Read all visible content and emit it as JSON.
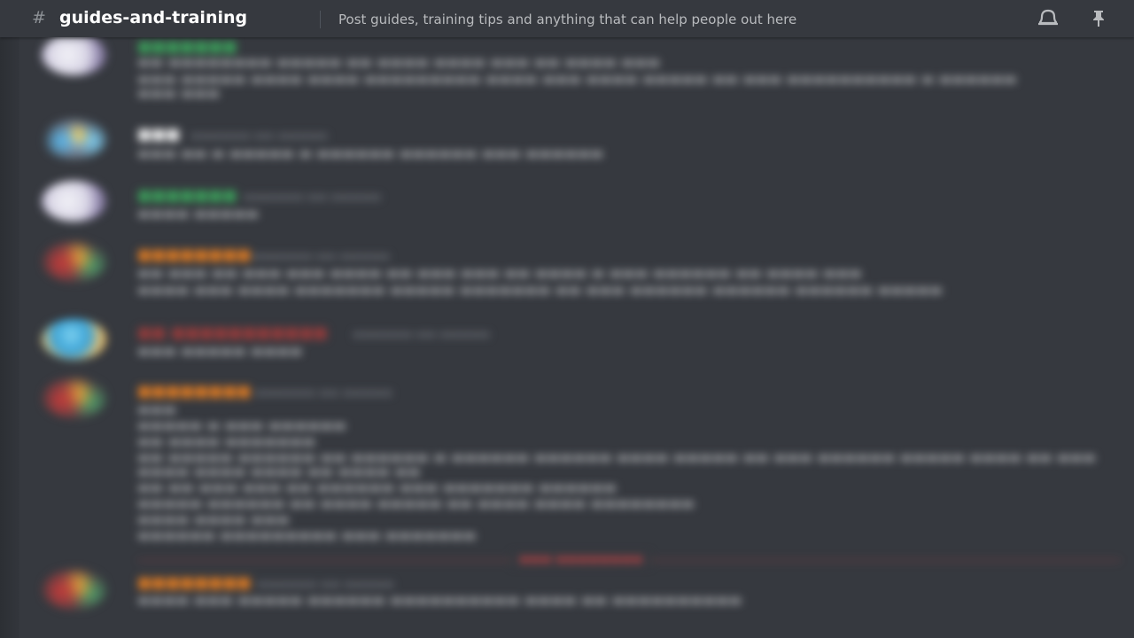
{
  "header": {
    "hash": "#",
    "channel_name": "guides-and-training",
    "topic": "Post guides, training tips and anything that can help people out here",
    "icons": [
      "notification-bell-icon",
      "pin-icon"
    ]
  },
  "colors": {
    "background": "#36393f",
    "header_text": "#ffffff",
    "topic_text": "#b9bbbe",
    "new_messages": "#f04747"
  },
  "messages_note": "message content blurred and unreadable",
  "avatars": [
    "ghost-avatar",
    "balls-avatar",
    "ghost-avatar",
    "rainbow-avatar",
    "globe-avatar",
    "rainbow-avatar",
    "rainbow-avatar"
  ]
}
